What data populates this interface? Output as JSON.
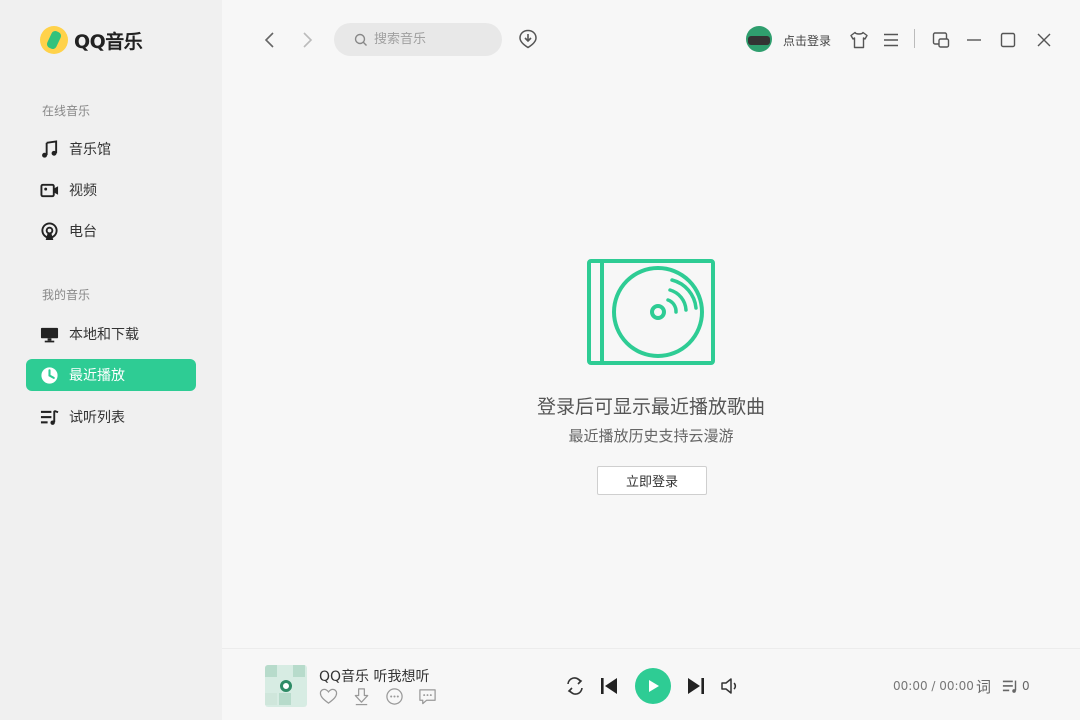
{
  "app": {
    "logo_text": "QQ音乐"
  },
  "sidebar": {
    "online_title": "在线音乐",
    "online_items": [
      {
        "label": "音乐馆",
        "icon": "music-note-icon"
      },
      {
        "label": "视频",
        "icon": "video-camera-icon"
      },
      {
        "label": "电台",
        "icon": "radio-icon"
      }
    ],
    "my_title": "我的音乐",
    "my_items": [
      {
        "label": "本地和下载",
        "icon": "monitor-icon"
      },
      {
        "label": "最近播放",
        "icon": "clock-icon",
        "active": true
      },
      {
        "label": "试听列表",
        "icon": "playlist-icon"
      }
    ]
  },
  "topbar": {
    "search_placeholder": "搜索音乐",
    "login_label": "点击登录"
  },
  "empty_state": {
    "title": "登录后可显示最近播放歌曲",
    "subtitle": "最近播放历史支持云漫游",
    "button_label": "立即登录"
  },
  "player": {
    "song_title": "QQ音乐 听我想听",
    "time": "00:00 / 00:00",
    "lyric_label": "词",
    "queue_count": "0"
  },
  "colors": {
    "accent": "#2ecc94",
    "sidebar_bg": "#f0f0f0",
    "main_bg": "#f7f7f7"
  }
}
